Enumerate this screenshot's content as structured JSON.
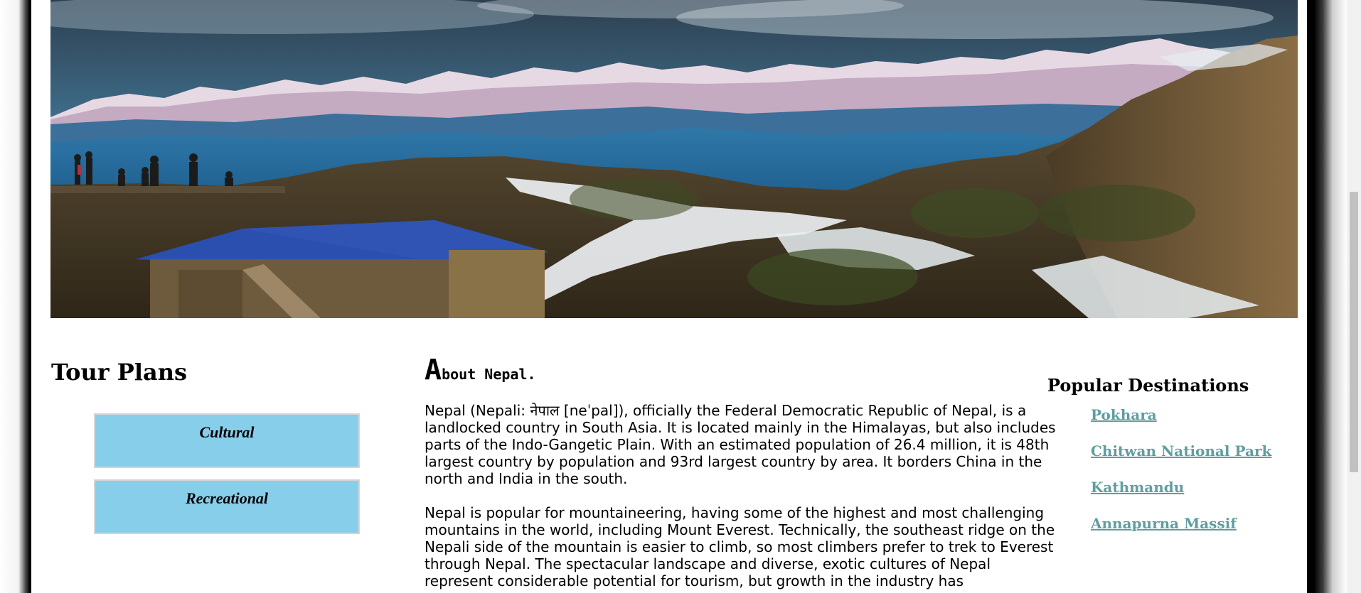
{
  "hero": {
    "image": "nepal-himalaya-mountain-landscape"
  },
  "tour_plans": {
    "title": "Tour Plans",
    "buttons": [
      {
        "label": "Cultural"
      },
      {
        "label": "Recreational"
      }
    ],
    "button_color": "#87ceeb"
  },
  "about": {
    "title_first_letter": "A",
    "title_rest": "bout Nepal.",
    "paragraphs": [
      "Nepal (Nepali: नेपाल [neˈpal]), officially the Federal Democratic Republic of Nepal, is a landlocked country in South Asia. It is located mainly in the Himalayas, but also includes parts of the Indo-Gangetic Plain. With an estimated population of 26.4 million, it is 48th largest country by population and 93rd largest country by area. It borders China in the north and India in the south.",
      "Nepal is popular for mountaineering, having some of the highest and most challenging mountains in the world, including Mount Everest. Technically, the southeast ridge on the Nepali side of the mountain is easier to climb, so most climbers prefer to trek to Everest through Nepal. The spectacular landscape and diverse, exotic cultures of Nepal represent considerable potential for tourism, but growth in the industry has"
    ]
  },
  "destinations": {
    "title": "Popular Destinations",
    "links": [
      {
        "label": "Pokhara"
      },
      {
        "label": "Chitwan National Park"
      },
      {
        "label": "Kathmandu"
      },
      {
        "label": "Annapurna Massif"
      }
    ],
    "link_color": "#5f9ea0"
  }
}
